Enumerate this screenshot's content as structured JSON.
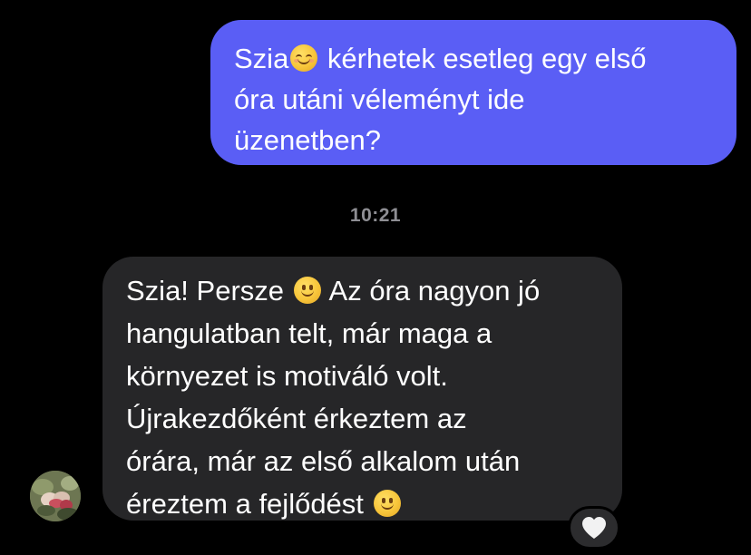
{
  "conversation": {
    "outgoing_message": {
      "lines": [
        {
          "before": "Szia",
          "emoji": "smiling-face-with-smiling-eyes",
          "after": " kérhetek esetleg egy első"
        },
        {
          "text": "óra utáni véleményt ide"
        },
        {
          "text": "üzenetben?"
        }
      ],
      "bubble_color": "#5a5ef5"
    },
    "timestamp": "10:21",
    "incoming_message": {
      "lines": [
        {
          "before": "Szia! Persze ",
          "emoji": "slightly-smiling-face",
          "after": " Az óra nagyon jó"
        },
        {
          "text": "hangulatban telt, már maga a"
        },
        {
          "text": "környezet is motiváló volt."
        },
        {
          "text": "Újrakezdőként érkeztem az"
        },
        {
          "text": "órára, már az első alkalom után"
        },
        {
          "before": "éreztem a fejlődést ",
          "emoji": "slightly-smiling-face"
        }
      ],
      "bubble_color": "#262628",
      "reaction": "white-heart-icon"
    },
    "sender_avatar": "avatar-photo"
  }
}
